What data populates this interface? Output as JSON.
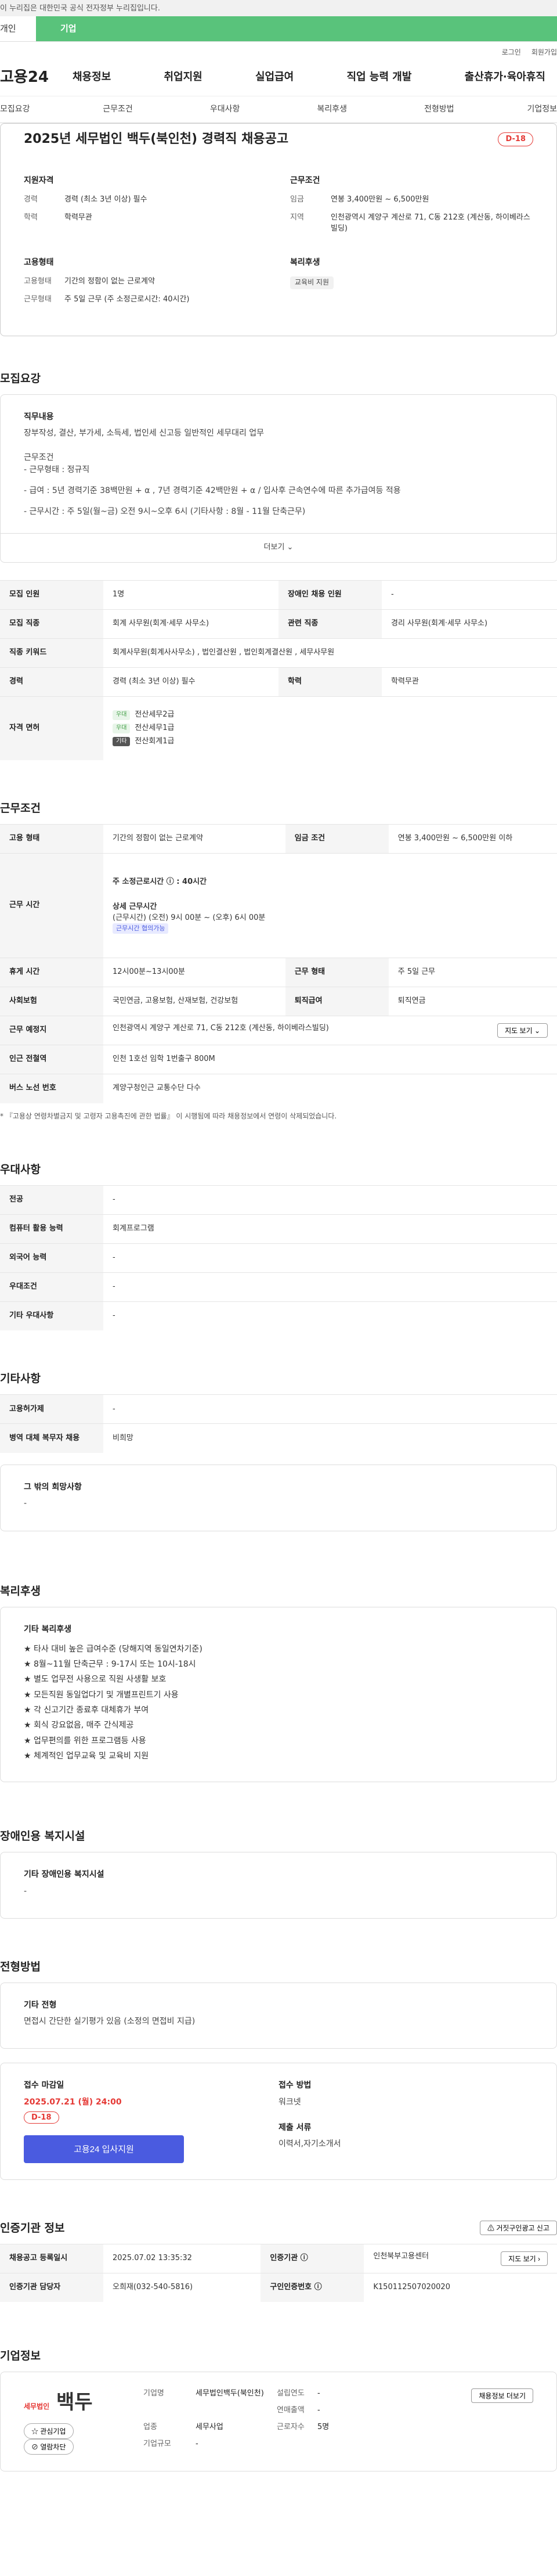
{
  "topbar": {
    "notice": "이 누리집은 대한민국 공식 전자정부 누리집입니다."
  },
  "toptabs": {
    "personal": "개인",
    "company": "기업"
  },
  "util": {
    "login": "로그인",
    "signup": "회원가입"
  },
  "logo": "고용24",
  "mainnav": [
    "채용정보",
    "취업지원",
    "실업급여",
    "직업 능력 개발",
    "출산휴가·육아휴직"
  ],
  "subnav": [
    "모집요강",
    "근무조건",
    "우대사항",
    "복리후생",
    "전형방법",
    "기업정보"
  ],
  "hero": {
    "title": "2025년 세무법인 백두(북인천) 경력직 채용공고",
    "dday": "D-18",
    "qualification": {
      "title": "지원자격",
      "career_k": "경력",
      "career_v": "경력 (최소 3년 이상) 필수",
      "edu_k": "학력",
      "edu_v": "학력무관"
    },
    "conditions": {
      "title": "근무조건",
      "wage_k": "임금",
      "wage_v": "연봉 3,400만원 ~ 6,500만원",
      "area_k": "지역",
      "area_v": "인천광역시 계양구 계산로 71, C동 212호 (계산동, 하이베라스빌딩)"
    },
    "employment": {
      "title": "고용형태",
      "type_k": "고용형태",
      "type_v": "기간의 정함이 없는 근로계약",
      "hours_k": "근무형태",
      "hours_v": "주 5일 근무 (주 소정근로시간: 40시간)"
    },
    "welfare": {
      "title": "복리후생",
      "tag": "교육비 지원"
    }
  },
  "recruit": {
    "title": "모집요강",
    "job_h": "직무내용",
    "job_desc": "장부작성, 결산, 부가세, 소득세, 법인세 신고등 일반적인 세무대리 업무",
    "cond_h": "근무조건",
    "cond_1": "- 근무형태 : 정규직",
    "cond_2": "- 급여 : 5년 경력기준 38백만원 + α , 7년 경력기준 42백만원 + α / 입사후 근속연수에 따른 추가급여등 적용",
    "cond_3": "- 근무시간 : 주 5일(월~금) 오전 9시~오후 6시 (기타사항 : 8월 - 11월 단축근무)",
    "more": "더보기 ⌄",
    "rows": {
      "count_h": "모집 인원",
      "count_v": "1명",
      "disabled_h": "장애인 채용 인원",
      "disabled_v": "-",
      "job_h": "모집 직종",
      "job_v": "회계 사무원(회계·세무 사무소)",
      "related_h": "관련 직종",
      "related_v": "경리 사무원(회계·세무 사무소)",
      "kw_h": "직종 키워드",
      "kw_v": "회계사무원(회계사사무소) , 법인결산원 , 법인회계결산원 , 세무사무원",
      "career_h": "경력",
      "career_v": "경력 (최소 3년 이상) 필수",
      "edu_h": "학력",
      "edu_v": "학력무관",
      "lic_h": "자격 면허",
      "licenses": [
        {
          "tag": "우대",
          "name": "전산세무2급"
        },
        {
          "tag": "우대",
          "name": "전산세무1급"
        },
        {
          "tag": "기타",
          "name": "전산회계1급"
        }
      ]
    }
  },
  "work": {
    "title": "근무조건",
    "type_h": "고용 형태",
    "type_v": "기간의 정함이 없는 근로계약",
    "wage_h": "임금 조건",
    "wage_v": "연봉 3,400만원 ~ 6,500만원 이하",
    "time_h": "근무 시간",
    "weekly": "주 소정근로시간 ⓘ : 40시간",
    "detail_h": "상세 근무시간",
    "detail_v": "(근무시간) (오전) 9시 00분 ~ (오후) 6시 00분",
    "detail_tag": "근무시간 협의가능",
    "rest_h": "휴게 시간",
    "rest_v": "12시00분~13시00분",
    "form_h": "근무 형태",
    "form_v": "주 5일 근무",
    "insure_h": "사회보험",
    "insure_v": "국민연금, 고용보험, 산재보험, 건강보험",
    "retire_h": "퇴직급여",
    "retire_v": "퇴직연금",
    "place_h": "근무 예정지",
    "place_v": "인천광역시 계양구 계산로 71, C동 212호 (계산동, 하이베라스빌딩)",
    "map": "지도 보기 ⌄",
    "subway_h": "인근 전철역",
    "subway_v": "인천 1호선 임학 1번출구 800M",
    "bus_h": "버스 노선 번호",
    "bus_v": "계양구청인근 교통수단 다수",
    "note": "* 『고용상 연령차별금지 및 고령자 고용촉진에 관한 법률』 이 시행됨에 따라 채용정보에서 연령이 삭제되었습니다."
  },
  "prefer": {
    "title": "우대사항",
    "rows": [
      {
        "h": "전공",
        "v": "-"
      },
      {
        "h": "컴퓨터 활용 능력",
        "v": "회계프로그램"
      },
      {
        "h": "외국어 능력",
        "v": "-"
      },
      {
        "h": "우대조건",
        "v": "-"
      },
      {
        "h": "기타 우대사항",
        "v": "-"
      }
    ]
  },
  "etc": {
    "title": "기타사항",
    "rows": [
      {
        "h": "고용허가제",
        "v": "-"
      },
      {
        "h": "병역 대체 복무자 채용",
        "v": "비희망"
      }
    ],
    "wish_h": "그 밖의 희망사항",
    "wish_v": "-"
  },
  "benefit": {
    "title": "복리후생",
    "h": "기타 복리후생",
    "items": [
      "★ 타사 대비 높은 급여수준 (당해지역 동일연차기준)",
      "★ 8월~11월 단축근무 : 9-17시 또는 10시-18시",
      "★ 별도 업무전 사용으로 직원 사생활 보호",
      "★ 모든직원 동일업다기 및 개별프린트기 사용",
      "★ 각 신고기간 종료후 대체휴가 부여",
      "★ 회식 강요없음, 매주 간식제공",
      "★ 업무편의를 위한 프로그램등 사용",
      "★ 체계적인 업무교육 및 교육비 지원"
    ]
  },
  "facility": {
    "title": "장애인용 복지시설",
    "h": "기타 장애인용 복지시설",
    "v": "-"
  },
  "screening": {
    "title": "전형방법",
    "h": "기타 전형",
    "v": "면접시 간단한 실기평가 있음 (소정의 면접비 지급)",
    "deadline_h": "접수 마감일",
    "deadline_v": "2025.07.21 (월) 24:00",
    "dday": "D-18",
    "apply": "고용24 입사지원",
    "method_h": "접수 방법",
    "method_v": "워크넷",
    "docs_h": "제출 서류",
    "docs_v": "이력서,자기소개서"
  },
  "cert": {
    "title": "인증기관 정보",
    "report": "⚠ 거짓구인광고 신고",
    "reg_h": "채용공고 등록일시",
    "reg_v": "2025.07.02 13:35:32",
    "org_h": "인증기관 ⓘ",
    "org_v": "인천북부고용센터",
    "map": "지도 보기 ›",
    "mgr_h": "인증기관 담당자",
    "mgr_v": "오희재(032-540-5816)",
    "no_h": "구인인증번호 ⓘ",
    "no_v": "K150112507020020"
  },
  "company": {
    "title": "기업정보",
    "logo_small": "세무법인",
    "logo_text": "백두",
    "interest": "☆ 관심기업",
    "block": "⊘ 열람차단",
    "name_k": "기업명",
    "name_v": "세무법인백두(북인천)",
    "founded_k": "설립연도",
    "founded_v": "-",
    "sales_k": "연매출액",
    "sales_v": "-",
    "industry_k": "업종",
    "industry_v": "세무사업",
    "emp_k": "근로자수",
    "emp_v": "5명",
    "size_k": "기업규모",
    "size_v": "-",
    "more": "채용정보 더보기"
  }
}
